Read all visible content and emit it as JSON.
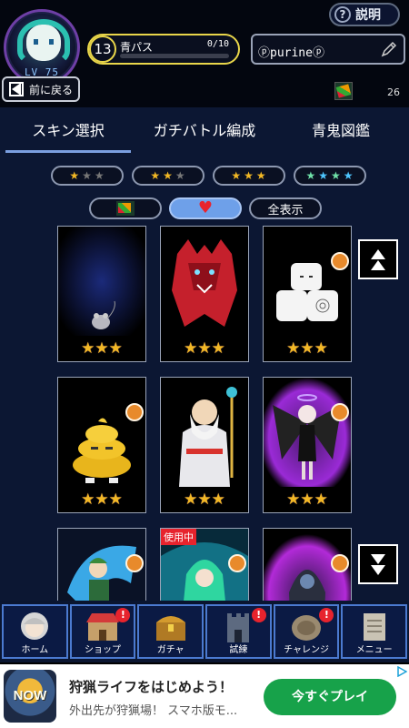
{
  "header": {
    "level_label": "LV 75",
    "help_label": "説明",
    "pass": {
      "level": "13",
      "name": "青パス",
      "progress_text": "0/10"
    },
    "player_name": "ⓟpurineⓟ",
    "back_label": "前に戻る",
    "item_count": "26"
  },
  "tabs": [
    {
      "label": "スキン選択",
      "active": true
    },
    {
      "label": "ガチバトル編成",
      "active": false
    },
    {
      "label": "青鬼図鑑",
      "active": false
    }
  ],
  "filters": {
    "rarity": [
      {
        "stars": "★★★",
        "lit": 1
      },
      {
        "stars": "★★★",
        "lit": 2
      },
      {
        "stars": "★★★",
        "lit": 3
      },
      {
        "stars": "★★★★",
        "lit": 4
      }
    ],
    "all_label": "全表示"
  },
  "skins": [
    {
      "name": "mouse",
      "stars": "★★★"
    },
    {
      "name": "red-wolf",
      "stars": "★★★"
    },
    {
      "name": "toilet-paper",
      "stars": "★★★"
    },
    {
      "name": "golden-poop",
      "stars": "★★★"
    },
    {
      "name": "zeus",
      "stars": "★★★"
    },
    {
      "name": "dark-angel",
      "stars": "★★★"
    },
    {
      "name": "ice-knight",
      "stars": ""
    },
    {
      "name": "green-hair-girl",
      "stars": "",
      "badge": "使用中"
    },
    {
      "name": "hooded-reaper",
      "stars": ""
    }
  ],
  "nav": [
    {
      "label": "ホーム",
      "icon": "avatar-icon",
      "notif": ""
    },
    {
      "label": "ショップ",
      "icon": "shop-icon",
      "notif": "!"
    },
    {
      "label": "ガチャ",
      "icon": "treasure-chest-icon",
      "notif": ""
    },
    {
      "label": "試練",
      "icon": "castle-icon",
      "notif": "!"
    },
    {
      "label": "チャレンジ",
      "icon": "coin-icon",
      "notif": "!"
    },
    {
      "label": "メニュー",
      "icon": "scroll-icon",
      "notif": ""
    }
  ],
  "ad": {
    "icon_text": "NOW",
    "title": "狩猟ライフをはじめよう！",
    "description": "外出先が狩猟場！ スマホ版モ...",
    "cta": "今すぐプレイ"
  },
  "colors": {
    "accent": "#6ea0e9",
    "gold": "#f2b825",
    "notify": "#e7232d",
    "panel": "#0c1733",
    "cta": "#17a24a"
  }
}
